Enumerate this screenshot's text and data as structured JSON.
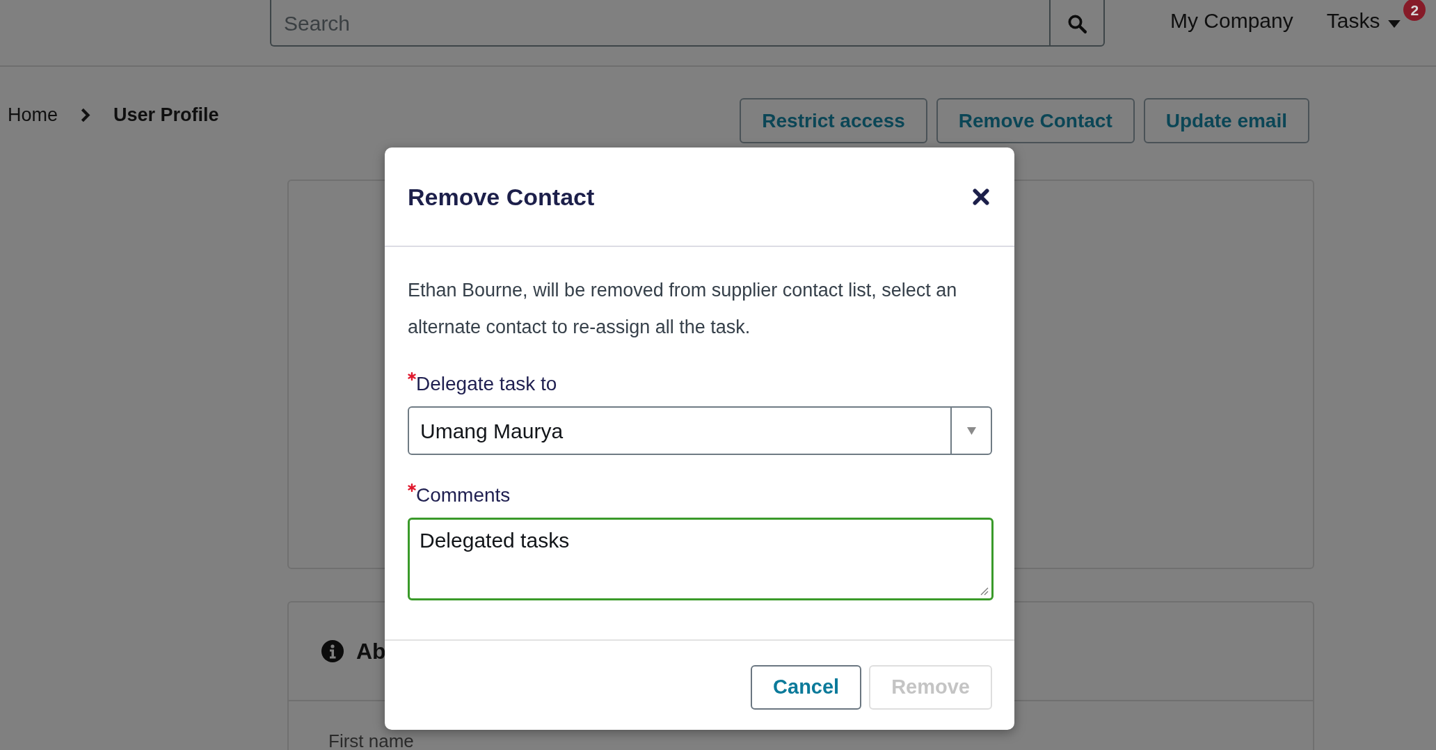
{
  "header": {
    "search": {
      "placeholder": "Search"
    },
    "nav": [
      {
        "kind": "link",
        "label": "My Company"
      },
      {
        "kind": "menu",
        "label": "Tasks",
        "badge": "2"
      }
    ]
  },
  "breadcrumb": [
    {
      "label": "Home",
      "current": false
    },
    {
      "label": "User Profile",
      "current": true
    }
  ],
  "actions": [
    "Restrict access",
    "Remove Contact",
    "Update email"
  ],
  "about_card": {
    "heading": "Ab",
    "fields": [
      {
        "label": "First name"
      }
    ]
  },
  "dialog": {
    "title": "Remove Contact",
    "message": "Ethan Bourne, will be removed from supplier contact list, select an alternate contact to re-assign all the task.",
    "fields": [
      {
        "kind": "select",
        "label": "Delegate task to",
        "required": true,
        "value": "Umang Maurya",
        "focused": false
      },
      {
        "kind": "textarea",
        "label": "Comments",
        "required": true,
        "value": "Delegated tasks",
        "focused": true
      }
    ],
    "buttons": [
      {
        "label": "Cancel",
        "disabled": false
      },
      {
        "label": "Remove",
        "disabled": true
      }
    ]
  }
}
